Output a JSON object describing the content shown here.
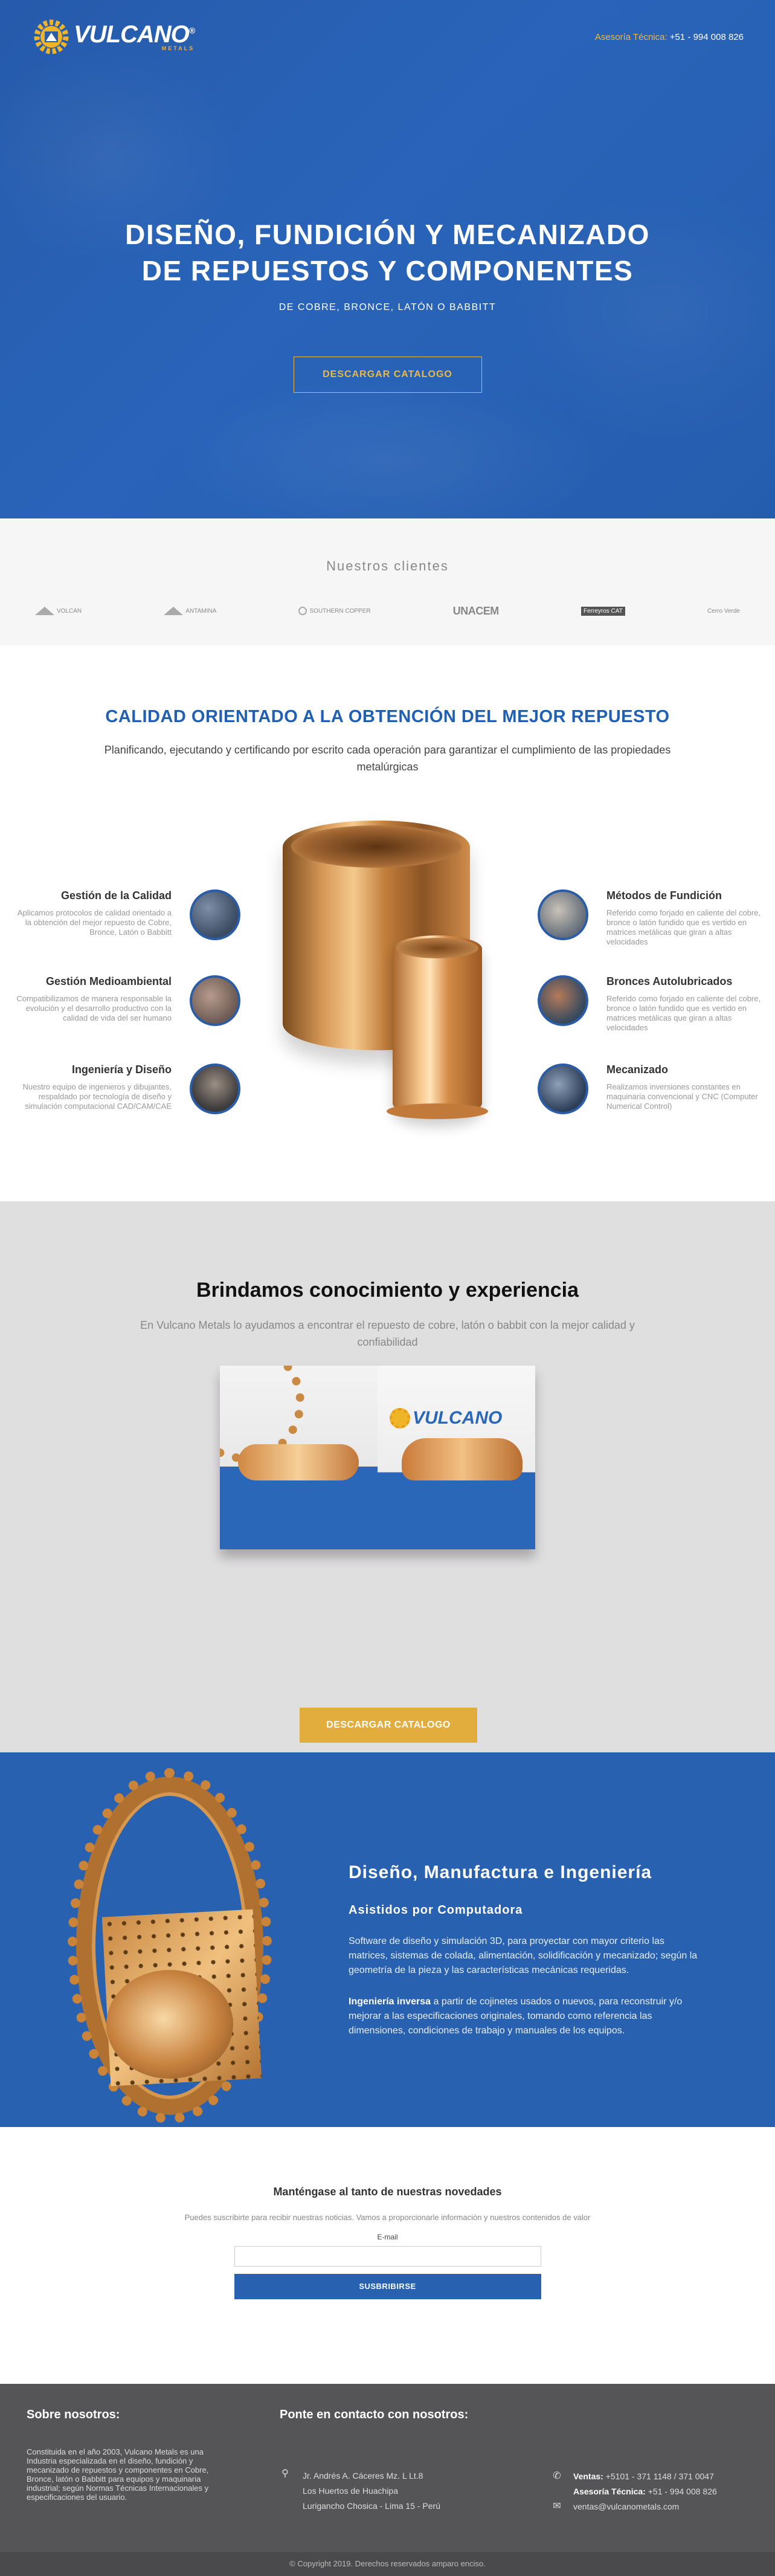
{
  "brand": {
    "name": "VULCANO",
    "sub": "METALS",
    "reg": "®"
  },
  "header": {
    "contact_label": "Asesoría Técnica:",
    "contact_number": "+51 - 994 008 826"
  },
  "hero": {
    "title_line1": "DISEÑO, FUNDICIÓN Y MECANIZADO",
    "title_line2": "DE REPUESTOS Y COMPONENTES",
    "subtitle": "DE COBRE, BRONCE, LATÓN O BABBITT",
    "cta": "DESCARGAR CATALOGO"
  },
  "clients": {
    "title": "Nuestros clientes",
    "logos": [
      "VOLCAN",
      "ANTAMINA",
      "SOUTHERN COPPER",
      "UNACEM",
      "Ferreyros CAT",
      "Cerro Verde"
    ]
  },
  "quality": {
    "title": "CALIDAD ORIENTADO A LA OBTENCIÓN DEL MEJOR REPUESTO",
    "lead": "Planificando, ejecutando y certificando por escrito cada operación para garantizar el cumplimiento de las propiedades metalúrgicas",
    "left": [
      {
        "title": "Gestión de la Calidad",
        "text": "Aplicamos protocolos de calidad orientado a la obtención del mejor repuesto de Cobre, Bronce, Latón o Babbitt"
      },
      {
        "title": "Gestión Medioambiental",
        "text": "Compatibilizamos de manera responsable la evolución y el desarrollo productivo con la calidad de vida del ser humano"
      },
      {
        "title": "Ingeniería y Diseño",
        "text": "Nuestro equipo de ingenieros y dibujantes, respaldado por tecnología de diseño y simulación computacional CAD/CAM/CAE"
      }
    ],
    "right": [
      {
        "title": "Métodos de Fundición",
        "text": "Referido como forjado en caliente del cobre, bronce o latón fundido que es vertido en matrices metálicas que giran a altas velocidades"
      },
      {
        "title": "Bronces Autolubricados",
        "text": "Referido como forjado en caliente del cobre, bronce o latón fundido que es vertido en matrices metálicas que giran a altas velocidades"
      },
      {
        "title": "Mecanizado",
        "text": "Realizamos inversiones constantes en maquinaria convencional y CNC (Computer Numerical Control)"
      }
    ]
  },
  "knowledge": {
    "title": "Brindamos conocimiento y experiencia",
    "lead": "En Vulcano Metals lo ayudamos a encontrar el repuesto de cobre, latón o babbit con la mejor calidad y confiabilidad",
    "cta": "DESCARGAR CATALOGO"
  },
  "design": {
    "title": "Diseño, Manufactura e Ingeniería",
    "subtitle": "Asistidos por Computadora",
    "p1": "Software de diseño y simulación 3D, para proyectar con mayor criterio las matrices, sistemas de colada, alimentación, solidificación y mecanizado; según la geometría de la pieza y las características mecánicas requeridas.",
    "p2_bold": "Ingeniería inversa",
    "p2": " a partir de cojinetes usados o nuevos, para reconstruir y/o mejorar a las especificaciones originales, tomando como referencia las dimensiones, condiciones de trabajo y manuales de los equipos."
  },
  "newsletter": {
    "title": "Manténgase al tanto de nuestras novedades",
    "desc": "Puedes suscribirte para recibir nuestras noticias. Vamos a proporcionarle información y nuestros contenidos de valor",
    "label": "E-mail",
    "button": "SUSBRIBIRSE"
  },
  "footer": {
    "about_title": "Sobre nosotros:",
    "about_text": "Constituida en el año 2003, Vulcano Metals es una Industria especializada en el diseño, fundición y mecanizado de repuestos y componentes en Cobre, Bronce, latón o Babbitt para equipos y maquinaria industrial; según Normas Técnicas Internacionales y especificaciones del usuario.",
    "contact_title": "Ponte en contacto con nosotros:",
    "address": [
      "Jr. Andrés A. Cáceres Mz. L Lt.8",
      "Los Huertos de Huachipa",
      "Lurigancho Chosica - Lima 15 - Perú"
    ],
    "sales_label": "Ventas:",
    "sales_value": "+5101 - 371 1148 / 371 0047",
    "tech_label": "Asesoría Técnica:",
    "tech_value": "+51 - 994 008 826",
    "email": "ventas@vulcanometals.com",
    "copyright": "© Copyright 2019. Derechos reservados amparo enciso."
  }
}
